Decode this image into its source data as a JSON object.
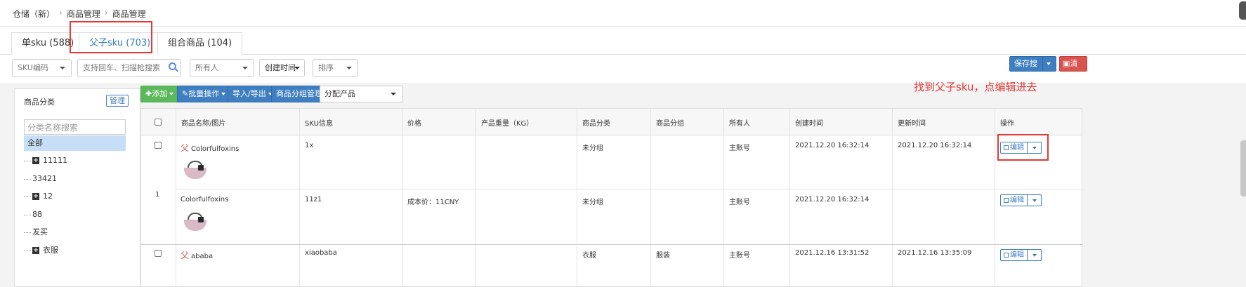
{
  "breadcrumb": [
    "仓储（新）",
    "商品管理",
    "商品管理"
  ],
  "tabs": [
    {
      "label": "单sku (588)",
      "active": false
    },
    {
      "label": "父子sku (703)",
      "active": true
    },
    {
      "label": "组合商品 (104)",
      "active": false
    }
  ],
  "filters": {
    "sku_code": "SKU编码",
    "search_placeholder": "支持回车、扫描枪搜索",
    "owner": "所有人",
    "created_time": "创建时间",
    "sort": "排序",
    "save_search": "保存搜索",
    "clear": "清空"
  },
  "sidebar": {
    "title": "商品分类",
    "manage": "管理",
    "search_placeholder": "分类名称搜索",
    "all": "全部",
    "items": [
      {
        "label": "11111",
        "expandable": true
      },
      {
        "label": "33421",
        "expandable": false
      },
      {
        "label": "12",
        "expandable": true
      },
      {
        "label": "88",
        "expandable": false
      },
      {
        "label": "发买",
        "expandable": false
      },
      {
        "label": "衣服",
        "expandable": true
      }
    ]
  },
  "toolbar": {
    "add": "添加",
    "batch": "批量操作",
    "import_export": "导入/导出",
    "group_manage": "商品分组管理",
    "assign": "分配产品"
  },
  "table": {
    "columns": [
      "商品名称/图片",
      "SKU信息",
      "价格",
      "产品重量（KG）",
      "商品分类",
      "商品分组",
      "所有人",
      "创建时间",
      "更新时间",
      "操作"
    ],
    "group_index": "1",
    "rows": [
      {
        "badge": "父",
        "name": "Colorfulfoxins",
        "sku": "1x",
        "price": "",
        "weight": "",
        "category": "未分组",
        "group": "",
        "owner": "主账号",
        "created": "2021.12.20 16:32:14",
        "updated": "2021.12.20 16:32:14",
        "action": "编辑"
      },
      {
        "badge": "",
        "name": "Colorfulfoxins",
        "sku": "11z1",
        "price": "成本价：11CNY",
        "weight": "",
        "category": "未分组",
        "group": "",
        "owner": "主账号",
        "created": "2021.12.20 16:32:14",
        "updated": "",
        "action": "编辑"
      }
    ],
    "partial_row": {
      "badge": "父",
      "name": "ababa",
      "sku": "xiaobaba",
      "category": "衣服",
      "group": "服装",
      "owner": "主账号",
      "created": "2021.12.16 13:31:52",
      "updated": "2021.12.16 13:35:09",
      "action": "编辑"
    }
  },
  "annotation": "找到父子sku，点编辑进去",
  "colors": {
    "primary": "#3f7fc1",
    "danger": "#d9534f",
    "success": "#5cb85c",
    "annotation": "#e53935"
  }
}
